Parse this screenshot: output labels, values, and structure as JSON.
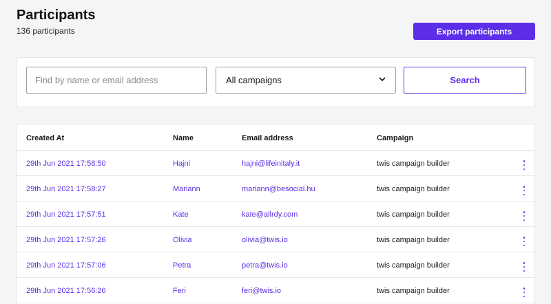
{
  "header": {
    "title": "Participants",
    "count_text": "136 participants",
    "export_label": "Export participants"
  },
  "filters": {
    "search_placeholder": "Find by name or email address",
    "campaign_selected": "All campaigns",
    "search_label": "Search"
  },
  "table": {
    "columns": [
      "Created At",
      "Name",
      "Email address",
      "Campaign"
    ],
    "rows": [
      {
        "created": "29th Jun 2021 17:58:50",
        "name": "Hajni",
        "email": "hajni@lifeinitaly.it",
        "campaign": "twis campaign builder"
      },
      {
        "created": "29th Jun 2021 17:58:27",
        "name": "Mariann",
        "email": "mariann@besocial.hu",
        "campaign": "twis campaign builder"
      },
      {
        "created": "29th Jun 2021 17:57:51",
        "name": "Kate",
        "email": "kate@allrdy.com",
        "campaign": "twis campaign builder"
      },
      {
        "created": "29th Jun 2021 17:57:26",
        "name": "Olivia",
        "email": "olivia@twis.io",
        "campaign": "twis campaign builder"
      },
      {
        "created": "29th Jun 2021 17:57:06",
        "name": "Petra",
        "email": "petra@twis.io",
        "campaign": "twis campaign builder"
      },
      {
        "created": "29th Jun 2021 17:56:26",
        "name": "Feri",
        "email": "feri@twis.io",
        "campaign": "twis campaign builder"
      }
    ]
  },
  "icons": {
    "row_menu": "more-vertical-icon",
    "select_caret": "chevron-down-icon"
  },
  "colors": {
    "accent": "#5c2ee8",
    "background": "#f5f5f6",
    "card": "#ffffff"
  }
}
